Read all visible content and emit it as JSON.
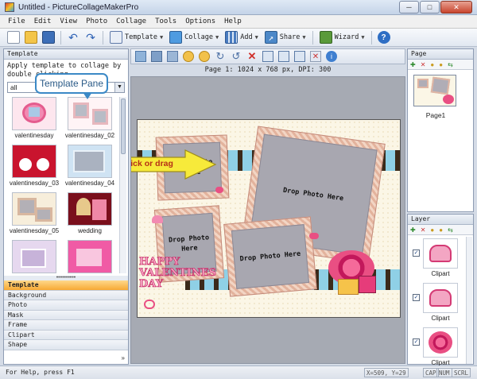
{
  "window": {
    "title": "Untitled - PictureCollageMakerPro",
    "controls": {
      "minimize": "─",
      "maximize": "□",
      "close": "✕"
    }
  },
  "menu": [
    "File",
    "Edit",
    "View",
    "Photo",
    "Collage",
    "Tools",
    "Options",
    "Help"
  ],
  "toolbar": {
    "template_label": "Template",
    "collage_label": "Collage",
    "add_label": "Add",
    "share_label": "Share",
    "wizard_label": "Wizard"
  },
  "template_panel": {
    "header": "Template",
    "hint": "Apply template to collage by double clicking",
    "filter_value": "all",
    "items": [
      {
        "label": "valentinesday"
      },
      {
        "label": "valentinesday_02"
      },
      {
        "label": "valentinesday_03"
      },
      {
        "label": "valentinesday_04"
      },
      {
        "label": "valentinesday_05"
      },
      {
        "label": "wedding"
      },
      {
        "label": ""
      },
      {
        "label": ""
      }
    ],
    "categories": [
      "Template",
      "Background",
      "Photo",
      "Mask",
      "Frame",
      "Clipart",
      "Shape"
    ],
    "more": "»"
  },
  "callout": {
    "text": "Template Pane"
  },
  "canvas": {
    "page_info": "Page 1: 1024 x 768 px, DPI: 300",
    "drag_hint": "Double click or drag",
    "drop_label": "Drop Photo Here",
    "drop_label_split": [
      "Drop Photo",
      "Here"
    ],
    "decor_text": "HAPPY VALENTINES DAY"
  },
  "page_panel": {
    "header": "Page",
    "pages": [
      {
        "label": "Page1"
      }
    ]
  },
  "layer_panel": {
    "header": "Layer",
    "layers": [
      {
        "label": "Clipart",
        "checked": true
      },
      {
        "label": "Clipart",
        "checked": true
      },
      {
        "label": "Clipart",
        "checked": true
      }
    ]
  },
  "status": {
    "help": "For Help, press F1",
    "coords": "X=509, Y=29",
    "cap": "CAP",
    "num": "NUM",
    "scrl": "SCRL"
  },
  "colors": {
    "accent": "#3b89c6",
    "active_category": "#f7a934",
    "arrow_fill": "#f7ea3a",
    "arrow_text": "#b53016",
    "frame": "#eccab7",
    "drop_zone": "#a8a7b0"
  }
}
